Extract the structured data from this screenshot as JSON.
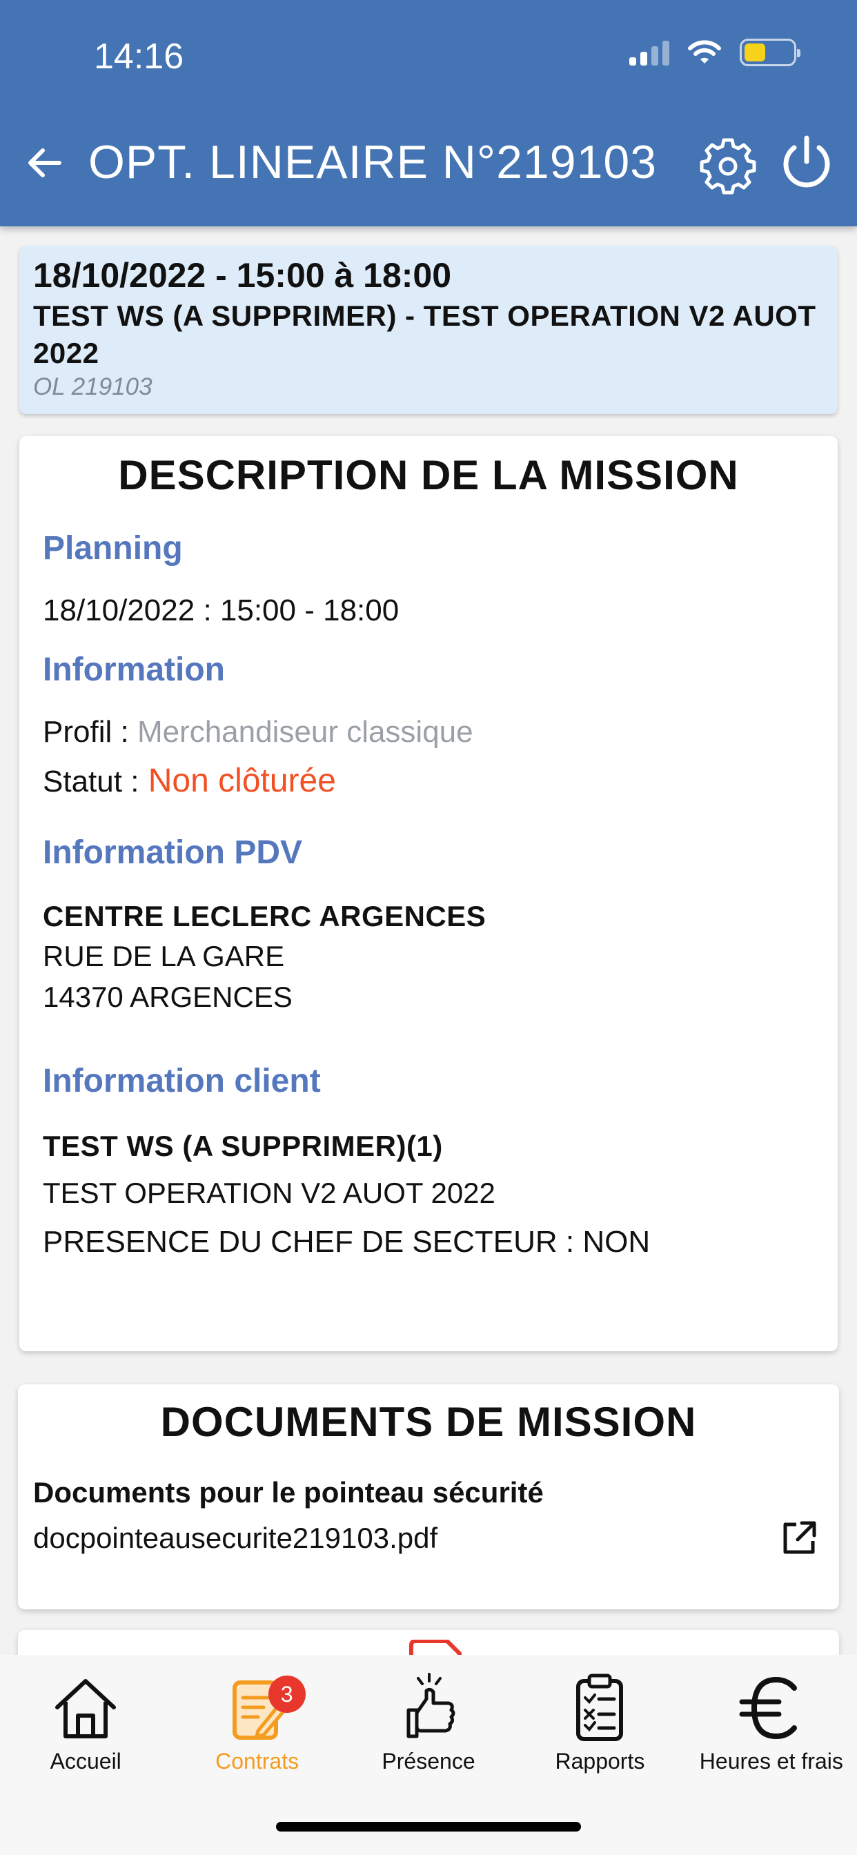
{
  "status_bar": {
    "time": "14:16",
    "signal_bars": 4,
    "signal_bars_active": 2,
    "battery_level": 0.35,
    "battery_color": "#f6d21a"
  },
  "header": {
    "title": "OPT. LINEAIRE N°219103",
    "back_icon": "arrow-left-icon",
    "settings_icon": "gear-icon",
    "power_icon": "power-icon",
    "background_color": "#4474b3"
  },
  "summary": {
    "datetime": "18/10/2022 - 15:00 à 18:00",
    "operation": "TEST WS (A SUPPRIMER) - TEST OPERATION V2 AUOT 2022",
    "reference": "OL 219103"
  },
  "description": {
    "title": "DESCRIPTION DE LA MISSION",
    "planning": {
      "heading": "Planning",
      "value": "18/10/2022 : 15:00 - 18:00"
    },
    "information": {
      "heading": "Information",
      "profil_label": "Profil :",
      "profil_value": "Merchandiseur classique",
      "statut_label": "Statut :",
      "statut_value": "Non clôturée"
    },
    "pdv": {
      "heading": "Information PDV",
      "name": "CENTRE  LECLERC ARGENCES",
      "street": "RUE DE LA GARE",
      "city": "14370 ARGENCES"
    },
    "client": {
      "heading": "Information client",
      "name": "TEST WS (A SUPPRIMER)(1)",
      "operation": "TEST OPERATION V2 AUOT 2022",
      "presence": "PRESENCE DU CHEF DE SECTEUR : NON"
    }
  },
  "documents": {
    "title": "DOCUMENTS DE MISSION",
    "subtitle": "Documents pour le pointeau sécurité",
    "file": "docpointeausecurite219103.pdf",
    "open_icon": "external-link-icon"
  },
  "nav": {
    "items": [
      {
        "label": "Accueil",
        "icon": "home-icon"
      },
      {
        "label": "Contrats",
        "icon": "contract-icon",
        "badge": "3",
        "active": true
      },
      {
        "label": "Présence",
        "icon": "presence-hand-icon"
      },
      {
        "label": "Rapports",
        "icon": "report-clipboard-icon"
      },
      {
        "label": "Heures et frais",
        "icon": "euro-icon"
      }
    ],
    "active_color": "#f39c1f"
  }
}
